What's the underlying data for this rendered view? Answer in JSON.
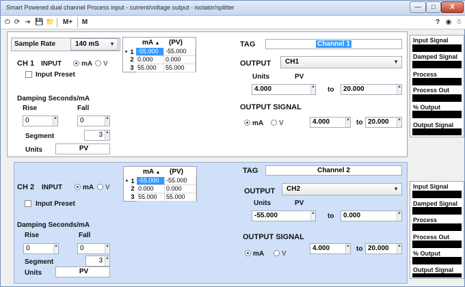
{
  "window": {
    "title": "Smart Powered dual channel Process input - current/voltage output - isolator/splitter",
    "minimize": "—",
    "maximize": "□",
    "close": "X"
  },
  "toolbar": {
    "icons": [
      "power-icon",
      "connect-icon",
      "connect-right-icon",
      "save-icon",
      "open-folder-icon"
    ],
    "glyphs": [
      "⏻",
      "⟳",
      "⇥",
      "💾",
      "📁"
    ],
    "m_plus": "M+",
    "m": "M",
    "right_glyphs": [
      "?",
      "◉",
      "☃"
    ]
  },
  "ch1": {
    "sample_rate_label": "Sample Rate",
    "sample_rate_value": "140 mS",
    "title": "CH 1",
    "input_label": "INPUT",
    "radio_ma": "mA",
    "radio_v": "V",
    "input_mode": "mA",
    "input_preset": "Input Preset",
    "table": {
      "col1": "mA",
      "col2": "(PV)",
      "rows": [
        {
          "n": "1",
          "ma": "-55.000",
          "pv": "-55.000"
        },
        {
          "n": "2",
          "ma": "0.000",
          "pv": "0.000"
        },
        {
          "n": "3",
          "ma": "55.000",
          "pv": "55.000"
        }
      ]
    },
    "damping_label": "Damping Seconds/mA",
    "rise_label": "Rise",
    "fall_label": "Fall",
    "rise_value": "0",
    "fall_value": "0",
    "segment_label": "Segment",
    "segment_value": "3",
    "units_label": "Units",
    "units_value": "PV",
    "tag_label": "TAG",
    "tag_value": "Channel 1",
    "output_label": "OUTPUT",
    "output_value": "CH1",
    "out_units_label": "Units",
    "out_units_value": "PV",
    "range_from": "4.000",
    "to_label": "to",
    "range_to": "20.000",
    "output_signal_label": "OUTPUT SIGNAL",
    "os_ma": "mA",
    "os_v": "V",
    "signal_from": "4.000",
    "signal_to": "20.000"
  },
  "ch2": {
    "title": "CH 2",
    "input_label": "INPUT",
    "radio_ma": "mA",
    "radio_v": "V",
    "input_preset": "Input Preset",
    "table": {
      "col1": "mA",
      "col2": "(PV)",
      "rows": [
        {
          "n": "1",
          "ma": "-55.000",
          "pv": "-55.000"
        },
        {
          "n": "2",
          "ma": "0.000",
          "pv": "0.000"
        },
        {
          "n": "3",
          "ma": "55.000",
          "pv": "55.000"
        }
      ]
    },
    "damping_label": "Damping Seconds/mA",
    "rise_label": "Rise",
    "fall_label": "Fall",
    "rise_value": "0",
    "fall_value": "0",
    "segment_label": "Segment",
    "segment_value": "3",
    "units_label": "Units",
    "units_value": "PV",
    "tag_label": "TAG",
    "tag_value": "Channel 2",
    "output_label": "OUTPUT",
    "output_value": "CH2",
    "out_units_label": "Units",
    "out_units_value": "PV",
    "range_from": "-55.000",
    "to_label": "to",
    "range_to": "0.000",
    "output_signal_label": "OUTPUT SIGNAL",
    "os_ma": "mA",
    "os_v": "V",
    "signal_from": "4.000",
    "signal_to": "20.000"
  },
  "side1": [
    "Input Signal",
    "Damped Signal",
    "Process",
    "Process Out",
    "% Output",
    "Output Signal"
  ],
  "side2": [
    "Input Signal",
    "Damped Signal",
    "Process",
    "Process Out",
    "% Output",
    "Output Signal"
  ]
}
